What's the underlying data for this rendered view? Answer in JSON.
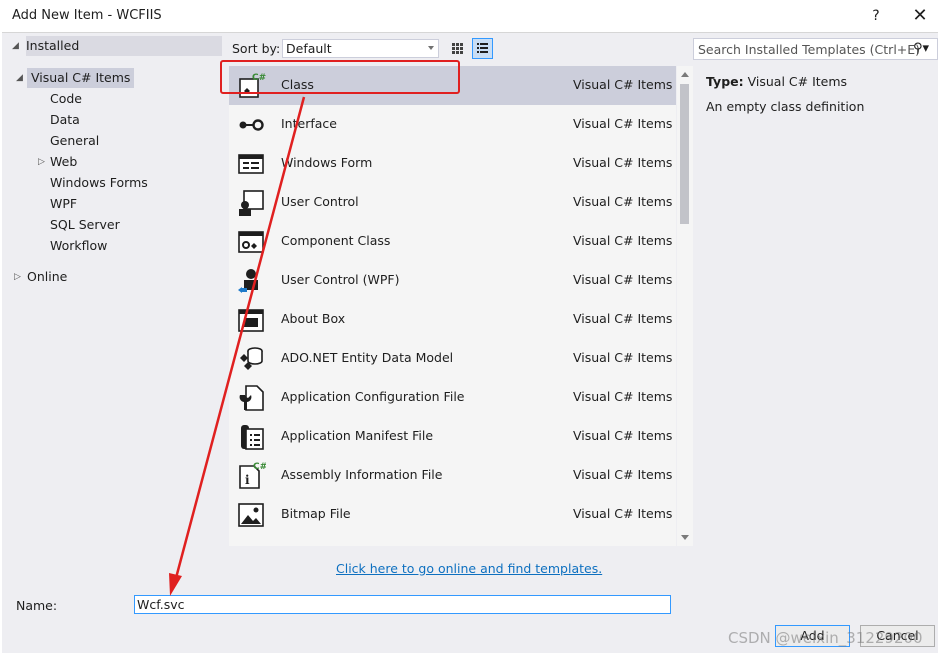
{
  "window": {
    "title": "Add New Item - WCFIIS",
    "help": "?",
    "close": "✕"
  },
  "tree": {
    "installed": "Installed",
    "visual_csharp": "Visual C# Items",
    "children": [
      "Code",
      "Data",
      "General",
      "Web",
      "Windows Forms",
      "WPF",
      "SQL Server",
      "Workflow"
    ],
    "online": "Online"
  },
  "toolbar": {
    "sort_label": "Sort by:",
    "sort_value": "Default",
    "search_placeholder": "Search Installed Templates (Ctrl+E)"
  },
  "templates": [
    {
      "name": "Class",
      "category": "Visual C# Items",
      "icon": "class-icon",
      "selected": true
    },
    {
      "name": "Interface",
      "category": "Visual C# Items",
      "icon": "interface-icon"
    },
    {
      "name": "Windows Form",
      "category": "Visual C# Items",
      "icon": "windows-form-icon"
    },
    {
      "name": "User Control",
      "category": "Visual C# Items",
      "icon": "user-control-icon"
    },
    {
      "name": "Component Class",
      "category": "Visual C# Items",
      "icon": "component-class-icon"
    },
    {
      "name": "User Control (WPF)",
      "category": "Visual C# Items",
      "icon": "user-control-wpf-icon"
    },
    {
      "name": "About Box",
      "category": "Visual C# Items",
      "icon": "about-box-icon"
    },
    {
      "name": "ADO.NET Entity Data Model",
      "category": "Visual C# Items",
      "icon": "entity-data-model-icon"
    },
    {
      "name": "Application Configuration File",
      "category": "Visual C# Items",
      "icon": "config-file-icon"
    },
    {
      "name": "Application Manifest File",
      "category": "Visual C# Items",
      "icon": "manifest-file-icon"
    },
    {
      "name": "Assembly Information File",
      "category": "Visual C# Items",
      "icon": "assembly-info-icon"
    },
    {
      "name": "Bitmap File",
      "category": "Visual C# Items",
      "icon": "bitmap-file-icon"
    }
  ],
  "info": {
    "type_label": "Type:",
    "type_value": "Visual C# Items",
    "description": "An empty class definition"
  },
  "online_link": "Click here to go online and find templates.",
  "name_label": "Name:",
  "name_value": "Wcf.svc",
  "buttons": {
    "add": "Add",
    "cancel": "Cancel"
  },
  "watermark": "CSDN @weixin_31229200",
  "annotation_color": "#e02020"
}
